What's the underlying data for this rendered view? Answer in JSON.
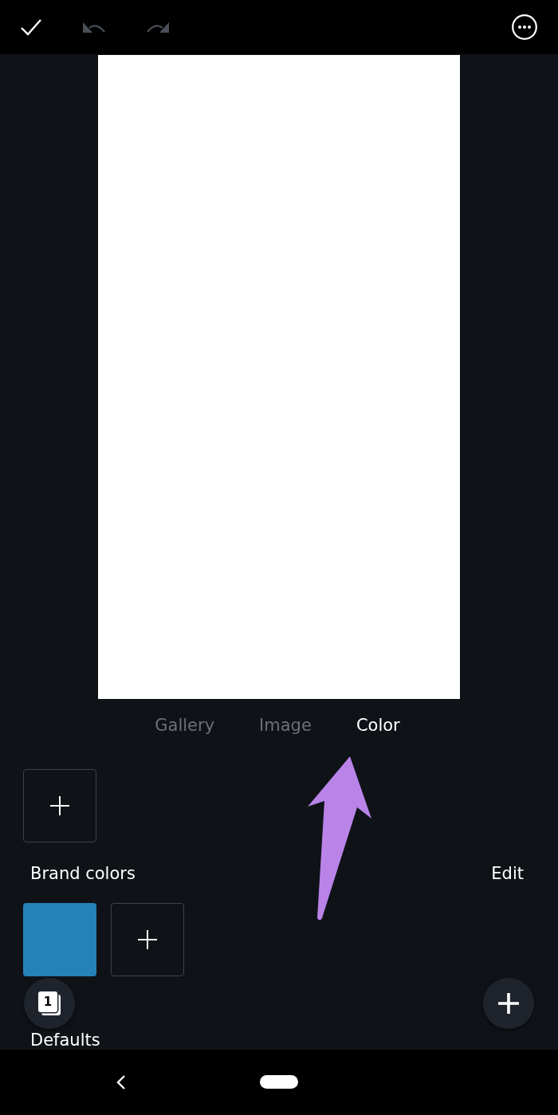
{
  "toolbar": [
    {
      "kind": "check",
      "disabled": false
    },
    {
      "kind": "undo",
      "disabled": true
    },
    {
      "kind": "redo",
      "disabled": true
    },
    {
      "kind": "more",
      "disabled": false
    }
  ],
  "tabs": [
    {
      "label": "Gallery",
      "selected": false
    },
    {
      "label": "Image",
      "selected": false
    },
    {
      "label": "Color",
      "selected": true
    }
  ],
  "brand_colors": {
    "title": "Brand colors",
    "action": "Edit",
    "swatches": [
      {
        "color": "#2581b8"
      }
    ]
  },
  "defaults": {
    "title": "Defaults"
  },
  "page_count": "1"
}
